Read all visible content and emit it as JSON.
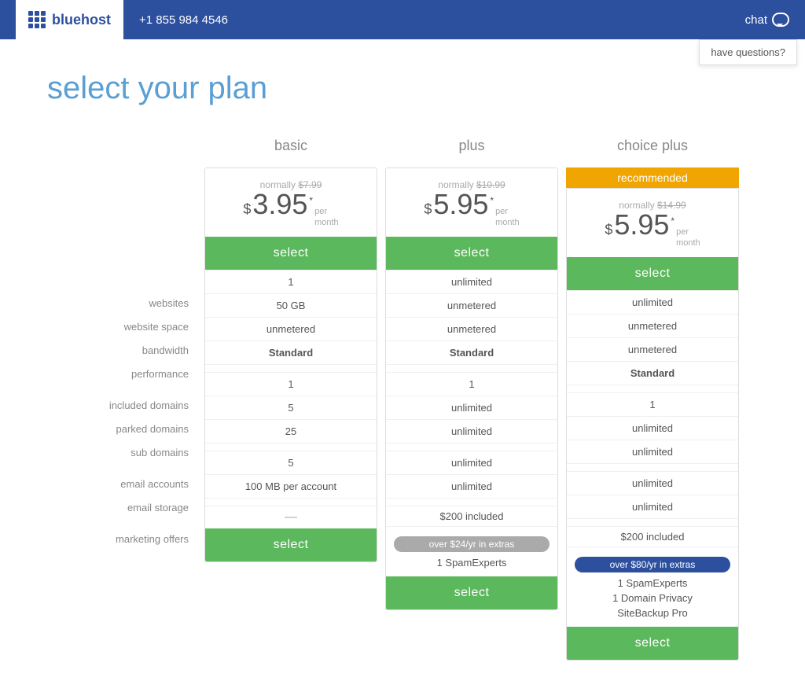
{
  "header": {
    "logo_text": "bluehost",
    "phone": "+1 855 984 4546",
    "chat_label": "chat",
    "have_questions": "have questions?"
  },
  "page": {
    "title": "select your plan"
  },
  "labels": {
    "websites": "websites",
    "website_space": "website space",
    "bandwidth": "bandwidth",
    "performance": "performance",
    "included_domains": "included domains",
    "parked_domains": "parked domains",
    "sub_domains": "sub domains",
    "email_accounts": "email accounts",
    "email_storage": "email storage",
    "marketing_offers": "marketing offers"
  },
  "plans": [
    {
      "id": "basic",
      "name": "basic",
      "recommended": false,
      "normally_label": "normally",
      "normally_price": "$7.99",
      "price": "$3.95",
      "asterisk": "*",
      "per_month": "per\nmonth",
      "select_label": "select",
      "websites": "1",
      "website_space": "50 GB",
      "bandwidth": "unmetered",
      "performance": "Standard",
      "included_domains": "1",
      "parked_domains": "5",
      "sub_domains": "25",
      "email_accounts": "5",
      "email_storage": "100 MB per account",
      "marketing_offers": "—",
      "extras_badge": null,
      "extras_items": []
    },
    {
      "id": "plus",
      "name": "plus",
      "recommended": false,
      "normally_label": "normally",
      "normally_price": "$10.99",
      "price": "$5.95",
      "asterisk": "*",
      "per_month": "per\nmonth",
      "select_label": "select",
      "websites": "unlimited",
      "website_space": "unmetered",
      "bandwidth": "unmetered",
      "performance": "Standard",
      "included_domains": "1",
      "parked_domains": "unlimited",
      "sub_domains": "unlimited",
      "email_accounts": "unlimited",
      "email_storage": "unlimited",
      "marketing_offers": "$200 included",
      "extras_badge": "over $24/yr in extras",
      "extras_badge_style": "gray",
      "extras_items": [
        "1 SpamExperts"
      ]
    },
    {
      "id": "choice-plus",
      "name": "choice plus",
      "recommended": true,
      "recommended_label": "recommended",
      "normally_label": "normally",
      "normally_price": "$14.99",
      "price": "$5.95",
      "asterisk": "*",
      "per_month": "per\nmonth",
      "select_label": "select",
      "websites": "unlimited",
      "website_space": "unmetered",
      "bandwidth": "unmetered",
      "performance": "Standard",
      "included_domains": "1",
      "parked_domains": "unlimited",
      "sub_domains": "unlimited",
      "email_accounts": "unlimited",
      "email_storage": "unlimited",
      "marketing_offers": "$200 included",
      "extras_badge": "over $80/yr in extras",
      "extras_badge_style": "blue",
      "extras_items": [
        "1 SpamExperts",
        "1 Domain Privacy",
        "SiteBackup Pro"
      ]
    }
  ]
}
